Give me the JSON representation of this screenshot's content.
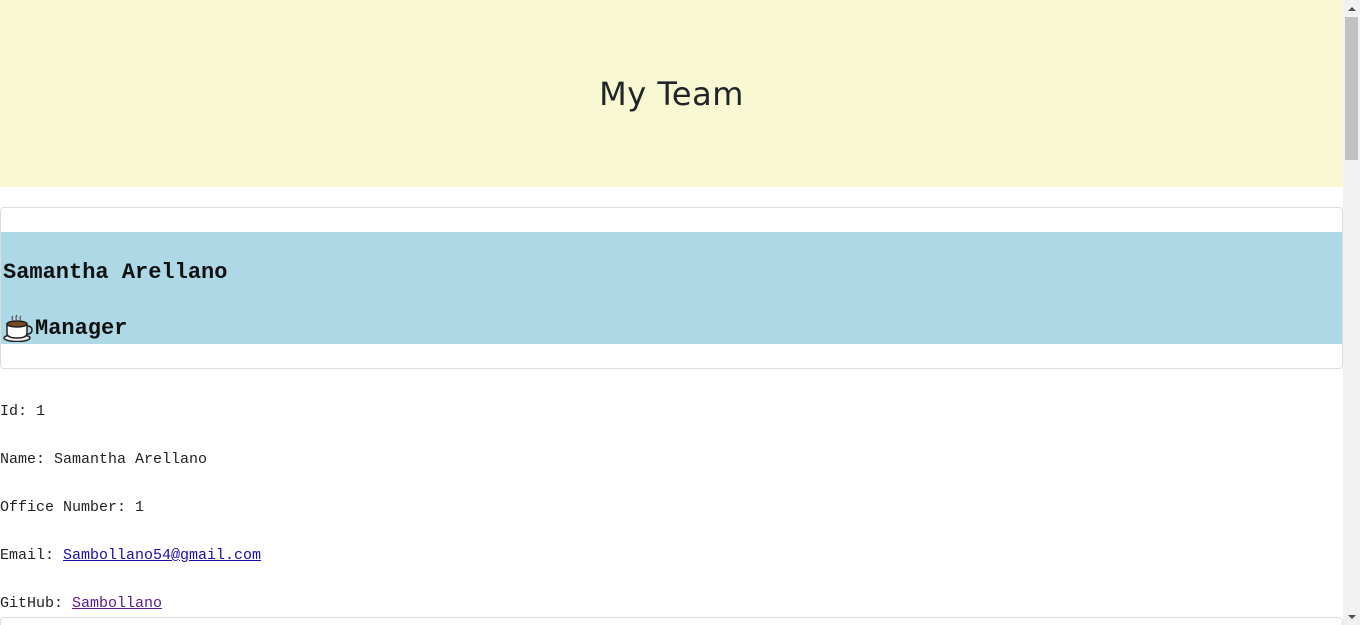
{
  "header": {
    "title": "My Team"
  },
  "employee": {
    "name": "Samantha Arellano",
    "role": "Manager",
    "role_icon": "coffee-mug-icon",
    "id_label": "Id: ",
    "id": "1",
    "name_label": "Name: ",
    "name_value": "Samantha Arellano",
    "office_label": "Office Number: ",
    "office": "1",
    "email_label": "Email: ",
    "email": "Sambollano54@gmail.com",
    "github_label": "GitHub: ",
    "github": "Sambollano"
  },
  "colors": {
    "jumbotron_bg": "#f8f9d2",
    "card_header_bg": "#add8e6",
    "link": "#1a0dab",
    "visited_link": "#551a8b"
  }
}
